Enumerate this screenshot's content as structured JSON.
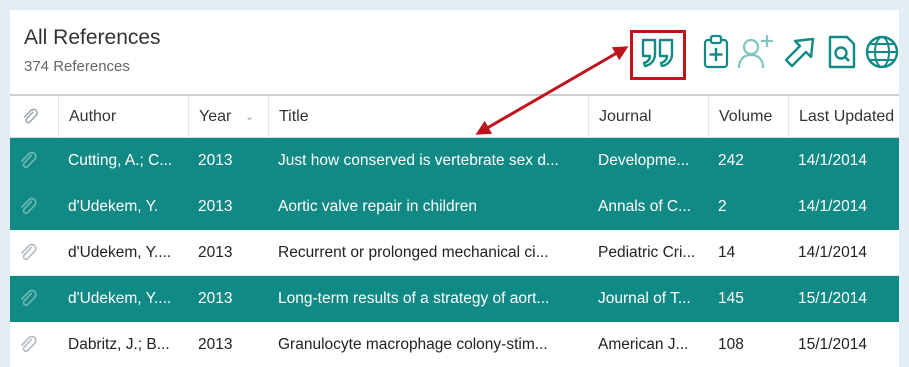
{
  "header": {
    "title": "All References",
    "count": "374 References"
  },
  "toolbar": {
    "icons": [
      "quote-icon",
      "clipboard-add-icon",
      "add-user-icon",
      "share-arrow-icon",
      "search-document-icon",
      "globe-icon"
    ]
  },
  "columns": {
    "attachment": "",
    "author": "Author",
    "year": "Year",
    "title": "Title",
    "journal": "Journal",
    "volume": "Volume",
    "updated": "Last Updated"
  },
  "rows": [
    {
      "author": "Cutting, A.; C...",
      "year": "2013",
      "title": "Just how conserved is vertebrate sex d...",
      "journal": "Developme...",
      "volume": "242",
      "updated": "14/1/2014",
      "selected": true
    },
    {
      "author": "d'Udekem, Y.",
      "year": "2013",
      "title": "Aortic valve repair in children",
      "journal": "Annals of C...",
      "volume": "2",
      "updated": "14/1/2014",
      "selected": true
    },
    {
      "author": "d'Udekem, Y....",
      "year": "2013",
      "title": "Recurrent or prolonged mechanical ci...",
      "journal": "Pediatric Cri...",
      "volume": "14",
      "updated": "14/1/2014",
      "selected": false
    },
    {
      "author": "d'Udekem, Y....",
      "year": "2013",
      "title": "Long-term results of a strategy of aort...",
      "journal": "Journal of T...",
      "volume": "145",
      "updated": "15/1/2014",
      "selected": true
    },
    {
      "author": "Dabritz, J.; B...",
      "year": "2013",
      "title": "Granulocyte macrophage colony-stim...",
      "journal": "American J...",
      "volume": "108",
      "updated": "15/1/2014",
      "selected": false
    }
  ],
  "colors": {
    "selected_row": "#118a85",
    "accent": "#118a85",
    "highlight": "#c0141c",
    "background": "#e3edf5"
  }
}
